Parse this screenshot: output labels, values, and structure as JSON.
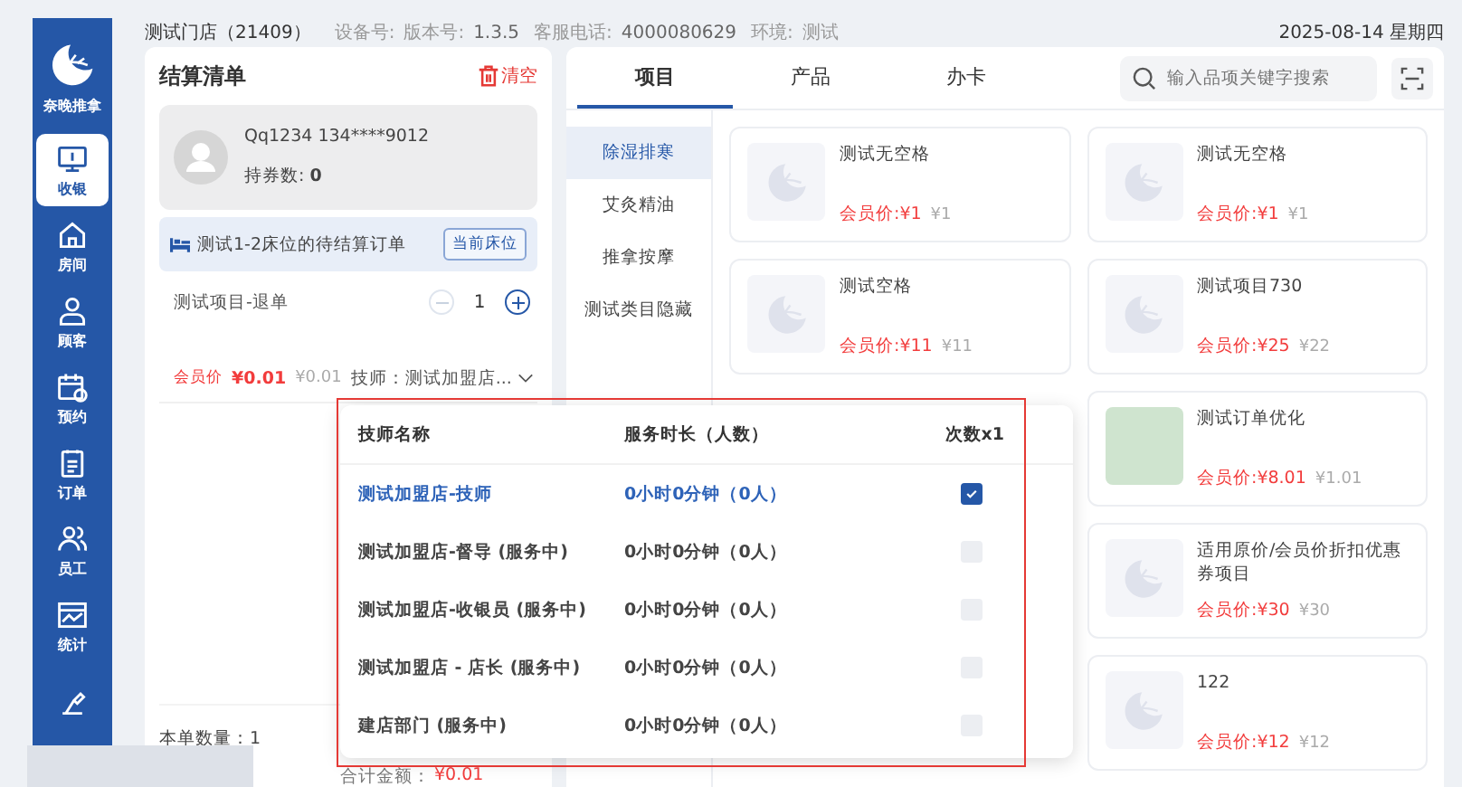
{
  "sidebar": {
    "brand": "奈晚推拿",
    "items": [
      {
        "label": "收银",
        "selected": true
      },
      {
        "label": "房间",
        "selected": false
      },
      {
        "label": "顾客",
        "selected": false
      },
      {
        "label": "预约",
        "selected": false
      },
      {
        "label": "订单",
        "selected": false
      },
      {
        "label": "员工",
        "selected": false
      },
      {
        "label": "统计",
        "selected": false
      },
      {
        "selected": false
      }
    ]
  },
  "header": {
    "store": "测试门店（21409）",
    "device_label": "设备号:",
    "version_label": "版本号:",
    "version": "1.3.5",
    "phone_label": "客服电话:",
    "phone": "4000080629",
    "env_label": "环境:",
    "env": "测试",
    "date": "2025-08-14 星期四"
  },
  "cart": {
    "title": "结算清单",
    "clear": "清空",
    "member": {
      "name": "Qq1234 134****9012",
      "coupons": "持券数: **0**"
    },
    "bed_order": "测试1-2床位的待结算订单",
    "bed_button": "当前床位",
    "item": {
      "name": "测试项目-退单",
      "quantity": "1",
      "member_label": "会员价",
      "member_price": "¥0.01",
      "price": "¥0.01",
      "tech": "技师：测试加盟店..."
    },
    "total_count": "本单数量：1",
    "total_amount_label": "合计金额：",
    "total_amount": "¥0.01"
  },
  "tabs": [
    {
      "label": "项目",
      "selected": true
    },
    {
      "label": "产品",
      "selected": false
    },
    {
      "label": "办卡",
      "selected": false
    }
  ],
  "search": {
    "placeholder": "输入品项关键字搜索"
  },
  "categories": [
    {
      "label": "除湿排寒",
      "selected": true
    },
    {
      "label": "艾灸精油",
      "selected": false
    },
    {
      "label": "推拿按摩",
      "selected": false
    },
    {
      "label": "测试类目隐藏",
      "selected": false
    }
  ],
  "product_columns": [
    [
      {
        "name": "测试无空格",
        "member_price": "会员价:¥1",
        "price": "¥1"
      },
      {
        "name": "测试空格",
        "member_price": "会员价:¥11",
        "price": "¥11"
      }
    ],
    [
      {
        "name": "测试无空格",
        "member_price": "会员价:¥1",
        "price": "¥1"
      },
      {
        "name": "测试项目730",
        "member_price": "会员价:¥25",
        "price": "¥22"
      },
      {
        "name": "测试订单优化",
        "member_price": "会员价:¥8.01",
        "price": "¥1.01"
      },
      {
        "name": "适用原价/会员价折扣优惠券项目",
        "member_price": "会员价:¥30",
        "price": "¥30"
      },
      {
        "name": "122",
        "member_price": "会员价:¥12",
        "price": "¥12"
      }
    ]
  ],
  "tech_popup": {
    "columns": [
      "技师名称",
      "服务时长（人数）",
      "次数x1"
    ],
    "rows": [
      {
        "name": "测试加盟店-技师",
        "duration": "0小时0分钟（0人）",
        "selected": true
      },
      {
        "name": "测试加盟店-督导 (服务中)",
        "duration": "0小时0分钟（0人）",
        "selected": false
      },
      {
        "name": "测试加盟店-收银员 (服务中)",
        "duration": "0小时0分钟（0人）",
        "selected": false
      },
      {
        "name": "测试加盟店 - 店长 (服务中)",
        "duration": "0小时0分钟（0人）",
        "selected": false
      },
      {
        "name": "建店部门 (服务中)",
        "duration": "0小时0分钟（0人）",
        "selected": false
      }
    ]
  }
}
